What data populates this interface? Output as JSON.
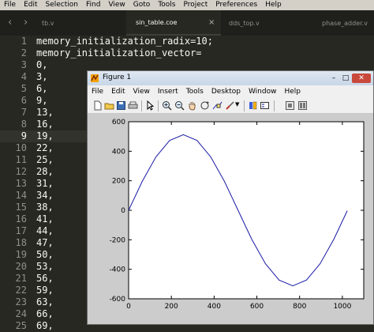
{
  "menubar": [
    "File",
    "Edit",
    "Selection",
    "Find",
    "View",
    "Goto",
    "Tools",
    "Project",
    "Preferences",
    "Help"
  ],
  "tabs": {
    "nav_left": "‹",
    "nav_right": "›",
    "items": [
      {
        "label": "tb.v"
      },
      {
        "label": "sin_table.coe",
        "active": true,
        "close": "×"
      },
      {
        "label": "dds_top.v"
      },
      {
        "label": "phase_adder.v"
      }
    ]
  },
  "editor": {
    "current_line": 9,
    "lines": [
      {
        "n": "1",
        "t": "memory_initialization_radix=10;"
      },
      {
        "n": "2",
        "t": "memory_initialization_vector="
      },
      {
        "n": "3",
        "t": "0,"
      },
      {
        "n": "4",
        "t": "3,"
      },
      {
        "n": "5",
        "t": "6,"
      },
      {
        "n": "6",
        "t": "9,"
      },
      {
        "n": "7",
        "t": "13,"
      },
      {
        "n": "8",
        "t": "16,"
      },
      {
        "n": "9",
        "t": "19,"
      },
      {
        "n": "10",
        "t": "22,"
      },
      {
        "n": "11",
        "t": "25,"
      },
      {
        "n": "12",
        "t": "28,"
      },
      {
        "n": "13",
        "t": "31,"
      },
      {
        "n": "14",
        "t": "34,"
      },
      {
        "n": "15",
        "t": "38,"
      },
      {
        "n": "16",
        "t": "41,"
      },
      {
        "n": "17",
        "t": "44,"
      },
      {
        "n": "18",
        "t": "47,"
      },
      {
        "n": "19",
        "t": "50,"
      },
      {
        "n": "20",
        "t": "53,"
      },
      {
        "n": "21",
        "t": "56,"
      },
      {
        "n": "22",
        "t": "59,"
      },
      {
        "n": "23",
        "t": "63,"
      },
      {
        "n": "24",
        "t": "66,"
      },
      {
        "n": "25",
        "t": "69,"
      }
    ]
  },
  "figure": {
    "title": "Figure 1",
    "minimize": "–",
    "maximize": "□",
    "close": "✕",
    "menu": [
      "File",
      "Edit",
      "View",
      "Insert",
      "Tools",
      "Desktop",
      "Window",
      "Help"
    ],
    "toolbar_icons": [
      "new-file-icon",
      "open-folder-icon",
      "save-icon",
      "print-icon",
      "arrow-select-icon",
      "zoom-in-icon",
      "zoom-out-icon",
      "pan-hand-icon",
      "rotate-3d-icon",
      "data-cursor-icon",
      "brush-icon",
      "dropdown-arrow-icon",
      "colorbar-icon",
      "legend-icon",
      "hide-plot-tools-icon",
      "show-plot-tools-icon"
    ]
  },
  "chart_data": {
    "type": "line",
    "title": "",
    "xlabel": "",
    "ylabel": "",
    "xlim": [
      0,
      1100
    ],
    "ylim": [
      -600,
      600
    ],
    "xticks": [
      0,
      200,
      400,
      600,
      800,
      1000
    ],
    "yticks": [
      -600,
      -400,
      -200,
      0,
      200,
      400,
      600
    ],
    "grid": false,
    "series": [
      {
        "color": "#1a1aa6",
        "x": [
          0,
          64,
          128,
          192,
          256,
          320,
          384,
          448,
          512,
          576,
          640,
          704,
          768,
          832,
          896,
          960,
          1023
        ],
        "y": [
          0,
          196,
          362,
          473,
          512,
          473,
          362,
          196,
          0,
          -196,
          -362,
          -473,
          -512,
          -473,
          -362,
          -196,
          -3
        ]
      }
    ]
  }
}
